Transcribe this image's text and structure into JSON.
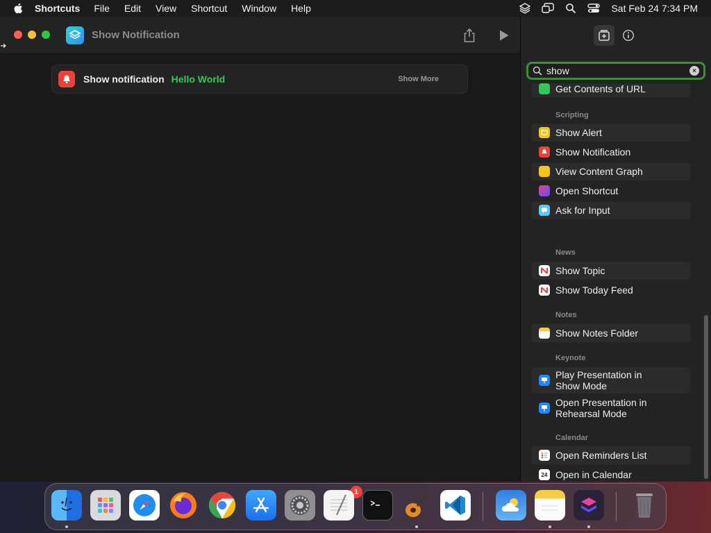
{
  "menubar": {
    "app_name": "Shortcuts",
    "items": [
      "File",
      "Edit",
      "View",
      "Shortcut",
      "Window",
      "Help"
    ],
    "clock": "Sat Feb 24  7:34 PM"
  },
  "window": {
    "title": "Show Notification"
  },
  "action": {
    "label": "Show notification",
    "parameter": "Hello World",
    "more": "Show More"
  },
  "search": {
    "value": "show"
  },
  "list": {
    "sections": {
      "scripting": "Scripting",
      "news": "News",
      "notes": "Notes",
      "keynote": "Keynote",
      "calendar": "Calendar"
    },
    "items": {
      "get_contents_url": "Get Contents of URL",
      "show_alert": "Show Alert",
      "show_notification": "Show Notification",
      "view_content_graph": "View Content Graph",
      "open_shortcut": "Open Shortcut",
      "ask_for_input": "Ask for Input",
      "show_topic": "Show Topic",
      "show_today_feed": "Show Today Feed",
      "show_notes_folder": "Show Notes Folder",
      "play_presentation_line1": "Play Presentation in",
      "play_presentation_line2": "Show Mode",
      "open_presentation_line1": "Open Presentation in",
      "open_presentation_line2": "Rehearsal Mode",
      "open_reminders_list": "Open Reminders List",
      "open_in_calendar": "Open in Calendar"
    }
  },
  "dock": {
    "settings_badge": "1",
    "calendar_day": "24"
  },
  "colors": {
    "accent_green": "#34c759",
    "search_border": "#3f8d3a",
    "notification_red": "#f0403a"
  }
}
